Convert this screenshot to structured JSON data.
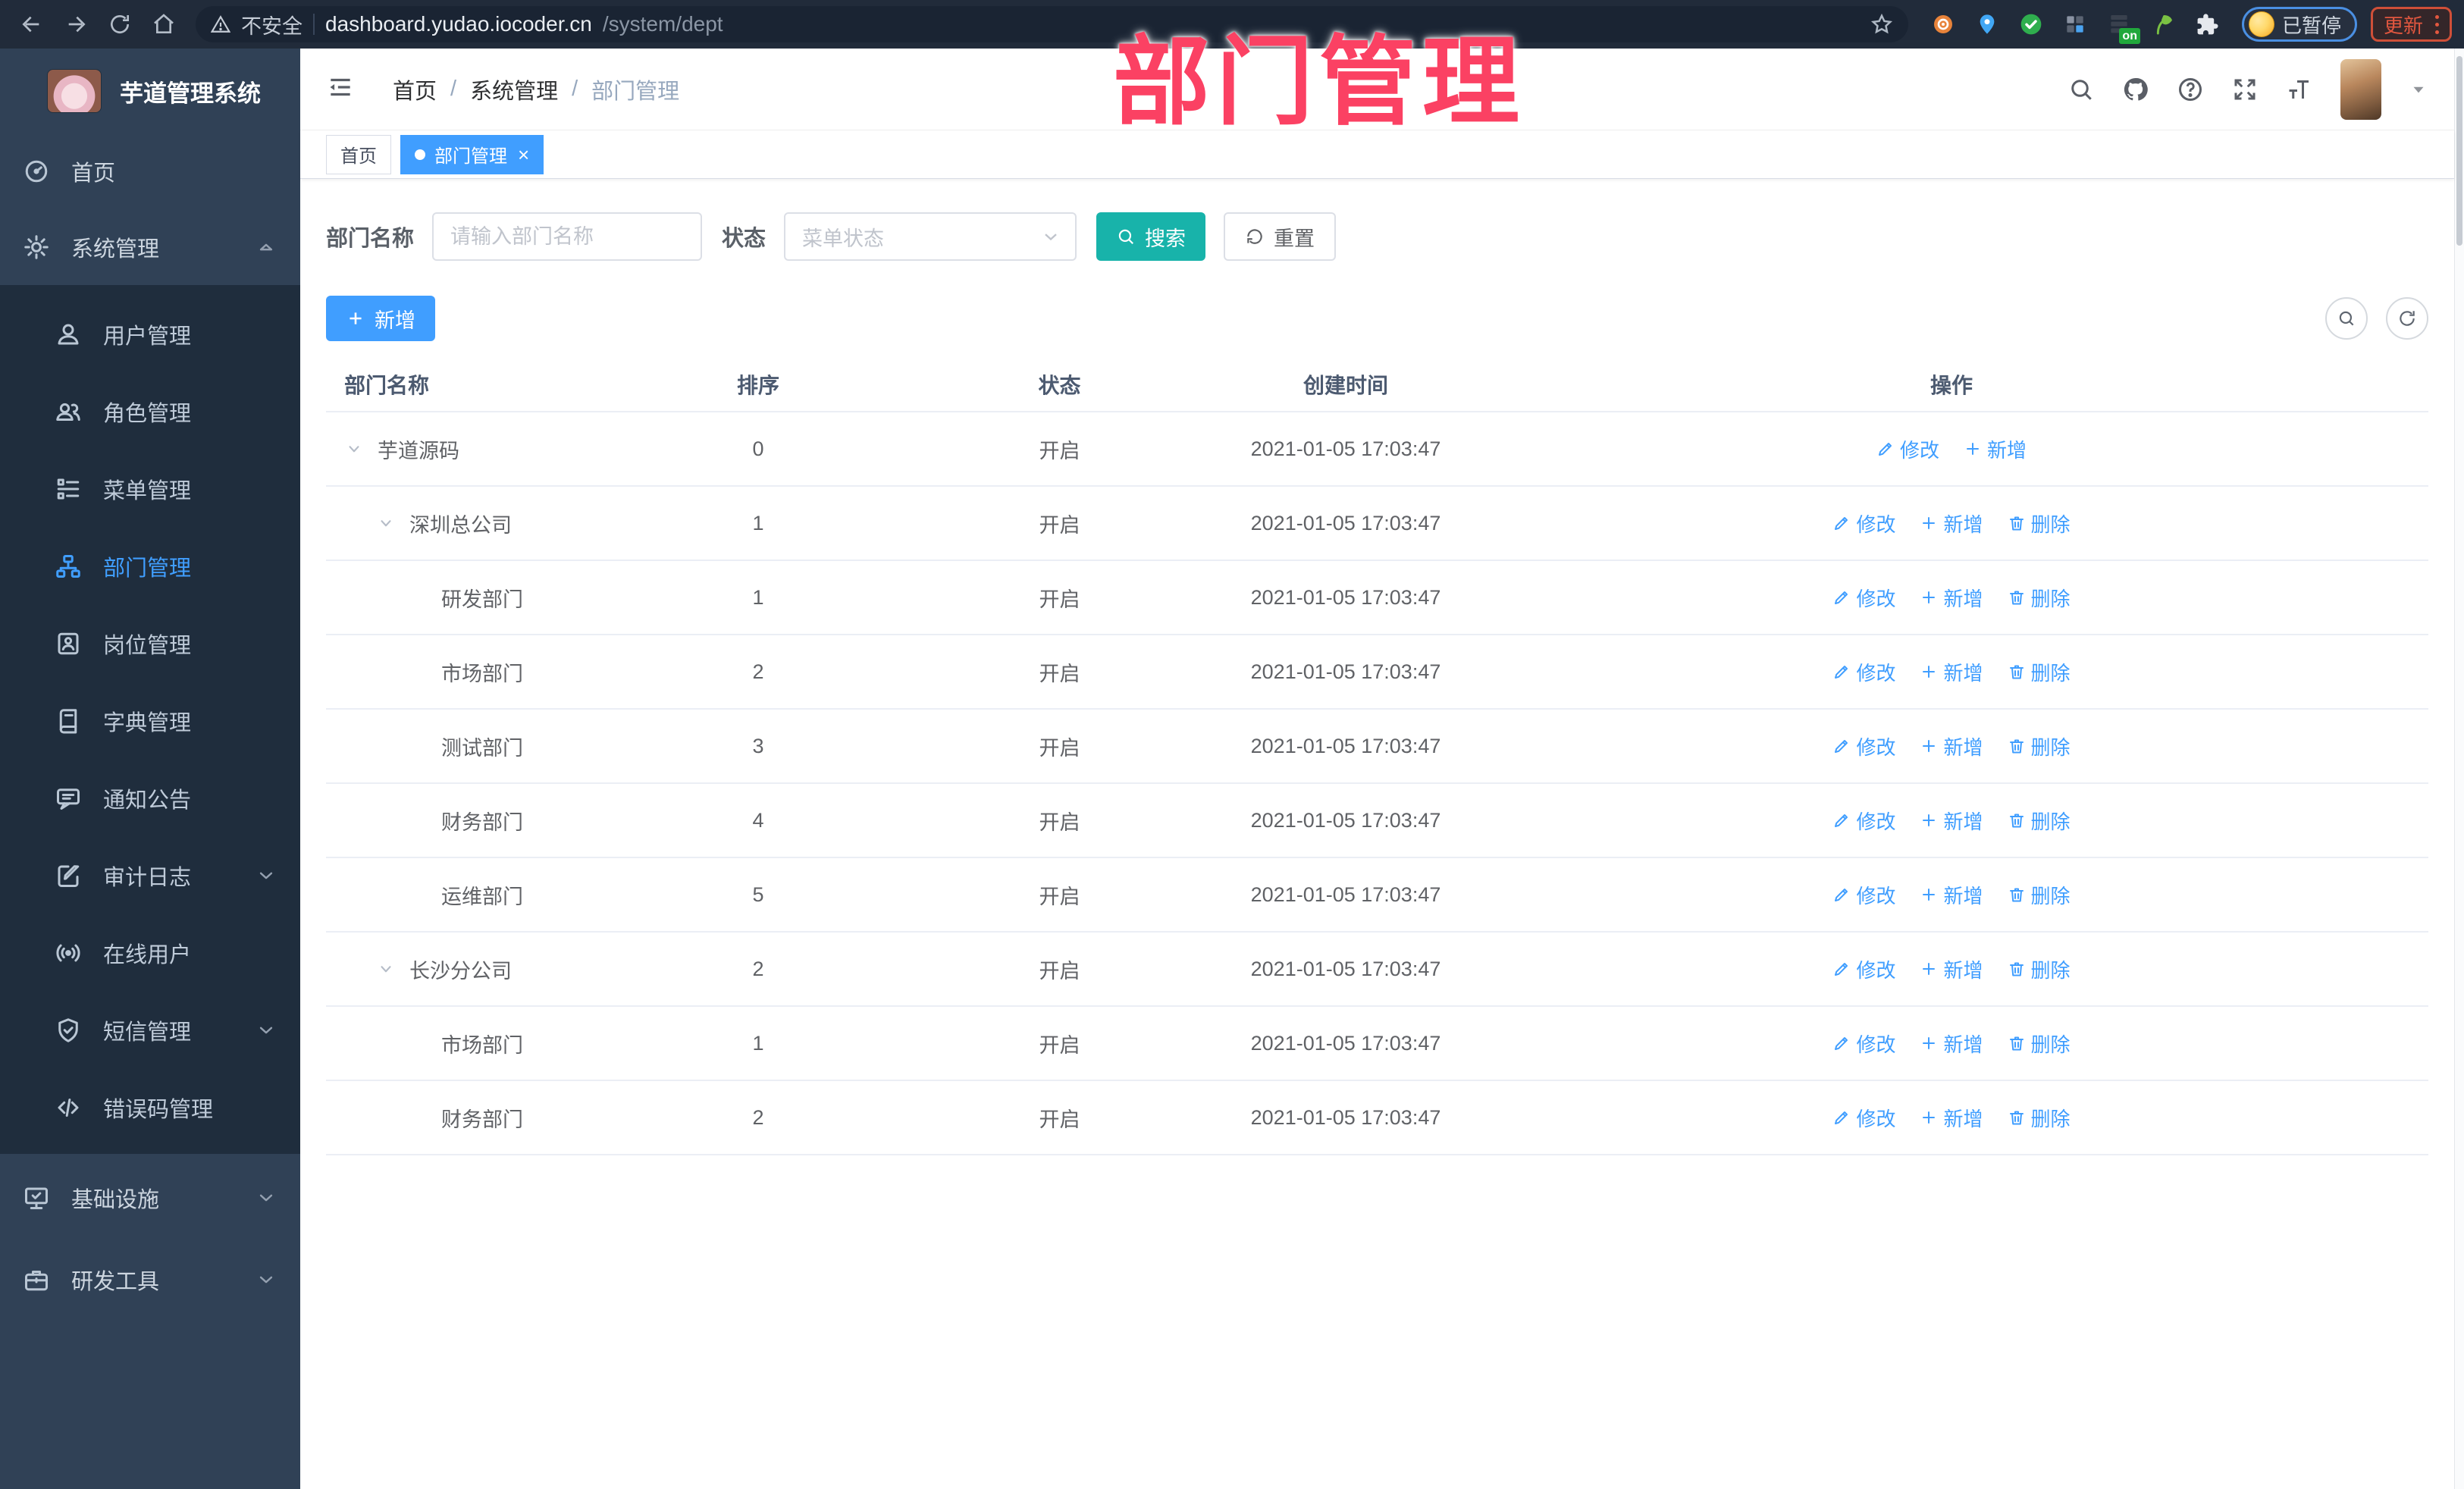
{
  "browser": {
    "security_label": "不安全",
    "url_host": "dashboard.yudao.iocoder.cn",
    "url_path": "/system/dept",
    "on_badge": "on",
    "paused_label": "已暂停",
    "update_label": "更新",
    "extensions": [
      "ext-dial-icon",
      "ext-pin-icon",
      "ext-check-icon",
      "ext-grid-icon",
      "ext-switch-icon",
      "ext-leaf-icon",
      "ext-puzzle-icon"
    ]
  },
  "overlay": {
    "title": "部门管理"
  },
  "sidebar": {
    "app_title": "芋道管理系统",
    "items": [
      {
        "label": "首页",
        "icon": "dashboard-icon",
        "sub": false
      },
      {
        "label": "系统管理",
        "icon": "gear-icon",
        "sub": false,
        "chevron": "up"
      },
      {
        "label": "用户管理",
        "icon": "user-icon",
        "sub": true
      },
      {
        "label": "角色管理",
        "icon": "users-icon",
        "sub": true
      },
      {
        "label": "菜单管理",
        "icon": "menu-list-icon",
        "sub": true
      },
      {
        "label": "部门管理",
        "icon": "org-tree-icon",
        "sub": true,
        "active": true
      },
      {
        "label": "岗位管理",
        "icon": "badge-icon",
        "sub": true
      },
      {
        "label": "字典管理",
        "icon": "book-icon",
        "sub": true
      },
      {
        "label": "通知公告",
        "icon": "announcement-icon",
        "sub": true
      },
      {
        "label": "审计日志",
        "icon": "audit-log-icon",
        "sub": true,
        "chevron": "down"
      },
      {
        "label": "在线用户",
        "icon": "online-user-icon",
        "sub": true
      },
      {
        "label": "短信管理",
        "icon": "sms-shield-icon",
        "sub": true,
        "chevron": "down"
      },
      {
        "label": "错误码管理",
        "icon": "error-code-icon",
        "sub": true
      },
      {
        "label": "基础设施",
        "icon": "infra-monitor-icon",
        "sub": false,
        "chevron": "down",
        "after": true
      },
      {
        "label": "研发工具",
        "icon": "devtools-icon",
        "sub": false,
        "chevron": "down",
        "after": true
      }
    ]
  },
  "navbar": {
    "breadcrumb": [
      "首页",
      "系统管理",
      "部门管理"
    ]
  },
  "tabs": [
    {
      "label": "首页",
      "active": false,
      "closable": false
    },
    {
      "label": "部门管理",
      "active": true,
      "closable": true
    }
  ],
  "filter": {
    "name_label": "部门名称",
    "name_placeholder": "请输入部门名称",
    "status_label": "状态",
    "status_placeholder": "菜单状态",
    "search_label": "搜索",
    "reset_label": "重置"
  },
  "toolbar": {
    "add_label": "新增"
  },
  "table": {
    "headers": [
      "部门名称",
      "排序",
      "状态",
      "创建时间",
      "操作"
    ],
    "action_labels": {
      "edit": "修改",
      "add": "新增",
      "delete": "删除"
    },
    "rows": [
      {
        "name": "芋道源码",
        "level": 1,
        "expandable": true,
        "sort": "0",
        "status": "开启",
        "time": "2021-01-05 17:03:47",
        "can_delete": false
      },
      {
        "name": "深圳总公司",
        "level": 2,
        "expandable": true,
        "sort": "1",
        "status": "开启",
        "time": "2021-01-05 17:03:47",
        "can_delete": true
      },
      {
        "name": "研发部门",
        "level": 3,
        "expandable": false,
        "sort": "1",
        "status": "开启",
        "time": "2021-01-05 17:03:47",
        "can_delete": true
      },
      {
        "name": "市场部门",
        "level": 3,
        "expandable": false,
        "sort": "2",
        "status": "开启",
        "time": "2021-01-05 17:03:47",
        "can_delete": true
      },
      {
        "name": "测试部门",
        "level": 3,
        "expandable": false,
        "sort": "3",
        "status": "开启",
        "time": "2021-01-05 17:03:47",
        "can_delete": true
      },
      {
        "name": "财务部门",
        "level": 3,
        "expandable": false,
        "sort": "4",
        "status": "开启",
        "time": "2021-01-05 17:03:47",
        "can_delete": true
      },
      {
        "name": "运维部门",
        "level": 3,
        "expandable": false,
        "sort": "5",
        "status": "开启",
        "time": "2021-01-05 17:03:47",
        "can_delete": true
      },
      {
        "name": "长沙分公司",
        "level": 2,
        "expandable": true,
        "sort": "2",
        "status": "开启",
        "time": "2021-01-05 17:03:47",
        "can_delete": true
      },
      {
        "name": "市场部门",
        "level": 3,
        "expandable": false,
        "sort": "1",
        "status": "开启",
        "time": "2021-01-05 17:03:47",
        "can_delete": true
      },
      {
        "name": "财务部门",
        "level": 3,
        "expandable": false,
        "sort": "2",
        "status": "开启",
        "time": "2021-01-05 17:03:47",
        "can_delete": true
      }
    ]
  },
  "colors": {
    "accent_blue": "#409eff",
    "teal": "#18b3aa",
    "annotation_pink": "#fb4163",
    "sidebar_bg": "#304156",
    "submenu_bg": "#1f2d3d",
    "chrome_bg": "#212b3a"
  }
}
